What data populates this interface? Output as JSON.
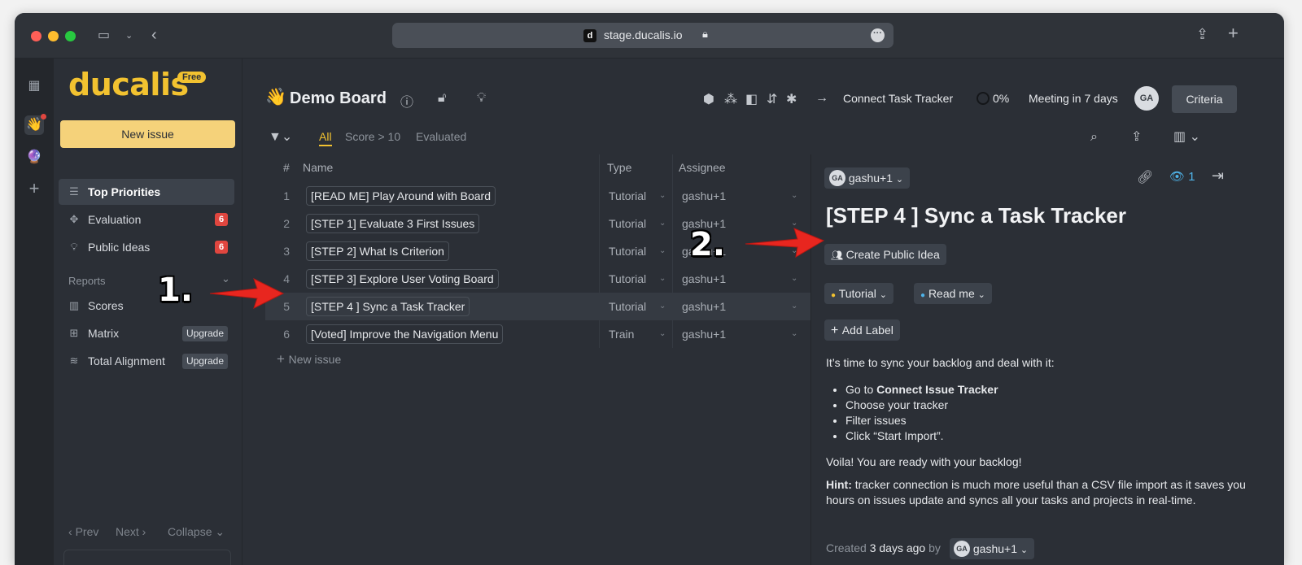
{
  "browser": {
    "url": "stage.ducalis.io"
  },
  "sidebar": {
    "logo": "ducalis",
    "free_badge": "Free",
    "new_issue": "New issue",
    "items": [
      {
        "label": "Top Priorities"
      },
      {
        "label": "Evaluation",
        "badge": "6"
      },
      {
        "label": "Public Ideas",
        "badge": "6"
      }
    ],
    "reports_label": "Reports",
    "reports": [
      {
        "label": "Scores"
      },
      {
        "label": "Matrix",
        "badge": "Upgrade"
      },
      {
        "label": "Total Alignment",
        "badge": "Upgrade"
      }
    ],
    "prev": "Prev",
    "next": "Next",
    "collapse": "Collapse"
  },
  "header": {
    "board_emoji": "👋",
    "board_title": "Demo Board",
    "connect": "Connect Task Tracker",
    "progress": "0%",
    "meeting": "Meeting in 7 days",
    "avatar": "GA",
    "criteria": "Criteria"
  },
  "filters": {
    "all": "All",
    "score": "Score > 10",
    "evaluated": "Evaluated"
  },
  "table": {
    "columns": {
      "num": "#",
      "name": "Name",
      "type": "Type",
      "assignee": "Assignee"
    },
    "rows": [
      {
        "num": "1",
        "name": "[READ ME] Play Around with Board",
        "type": "Tutorial",
        "assignee": "gashu+1"
      },
      {
        "num": "2",
        "name": "[STEP 1] Evaluate 3 First Issues",
        "type": "Tutorial",
        "assignee": "gashu+1"
      },
      {
        "num": "3",
        "name": "[STEP 2] What Is Criterion",
        "type": "Tutorial",
        "assignee": "gashu+1"
      },
      {
        "num": "4",
        "name": "[STEP 3] Explore User Voting Board",
        "type": "Tutorial",
        "assignee": "gashu+1"
      },
      {
        "num": "5",
        "name": "[STEP 4 ] Sync a Task Tracker",
        "type": "Tutorial",
        "assignee": "gashu+1"
      },
      {
        "num": "6",
        "name": "[Voted] Improve the Navigation Menu",
        "type": "Train",
        "assignee": "gashu+1"
      }
    ],
    "new_issue": "New issue"
  },
  "panel": {
    "assignee_avatar": "GA",
    "assignee": "gashu+1",
    "watchers": "1",
    "title": "[STEP 4 ] Sync a Task Tracker",
    "create_public_idea": "Create Public Idea",
    "labels": [
      {
        "text": "Tutorial",
        "color": "#f2c230"
      },
      {
        "text": "Read me",
        "color": "#4fb3e8"
      }
    ],
    "add_label": "Add Label",
    "intro": "It’s time to sync your backlog and deal with it:",
    "step1_prefix": "Go to ",
    "step1_bold": "Connect Issue Tracker",
    "step2": "Choose your tracker",
    "step3": "Filter issues",
    "step4": "Click “Start Import”.",
    "voila": "Voila! You are ready with your backlog!",
    "hint_label": "Hint:",
    "hint_text": " tracker connection is much more useful than a CSV file import as it saves you hours on issues update and syncs all your tasks and projects in real-time.",
    "created_prefix": "Created",
    "created_time": "3 days ago",
    "created_by": "by",
    "creator_avatar": "GA",
    "creator": "gashu+1"
  },
  "annotations": {
    "one": "1.",
    "two": "2."
  },
  "colors": {
    "accent": "#f2c230",
    "arrow": "#e8261f",
    "badge": "#e0463f"
  }
}
